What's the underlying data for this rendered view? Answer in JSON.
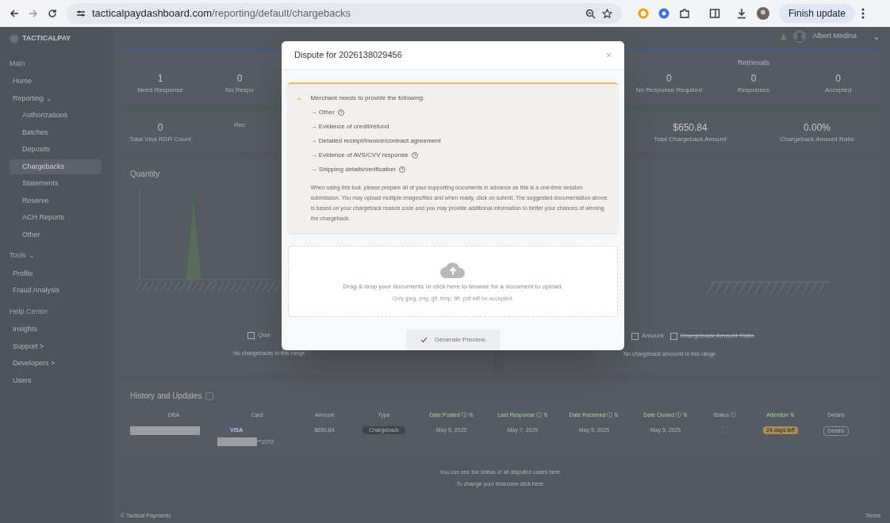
{
  "browser": {
    "url_host": "tacticalpaydashboard.com",
    "url_path": "/reporting/default/chargebacks",
    "update_button": "Finish update"
  },
  "sidebar": {
    "brand": "TACTICALPAY",
    "sections": [
      {
        "title": "Main",
        "items": [
          {
            "label": "Home",
            "selected": false
          },
          {
            "label": "Reporting ⌄",
            "selected": false,
            "children": [
              {
                "label": "Authorizations",
                "selected": false
              },
              {
                "label": "Batches",
                "selected": false
              },
              {
                "label": "Deposits",
                "selected": false
              },
              {
                "label": "Chargebacks",
                "selected": true
              },
              {
                "label": "Statements",
                "selected": false
              },
              {
                "label": "Reserve",
                "selected": false
              },
              {
                "label": "ACH Reports",
                "selected": false
              },
              {
                "label": "Other",
                "selected": false
              }
            ]
          }
        ]
      },
      {
        "title": "Tools ⌄",
        "items": [
          {
            "label": "Profile",
            "selected": false
          },
          {
            "label": "Fraud Analysis",
            "selected": false
          }
        ]
      },
      {
        "title": "Help Center",
        "items": [
          {
            "label": "Insights",
            "selected": false
          },
          {
            "label": "Support >",
            "selected": false
          },
          {
            "label": "Developers >",
            "selected": false
          },
          {
            "label": "Users",
            "selected": false
          }
        ]
      }
    ]
  },
  "user": {
    "name": "Albert Medina",
    "caret": "⌄"
  },
  "stats_row_1": {
    "left": [
      {
        "value": "1",
        "label": "Need Response"
      },
      {
        "value": "0",
        "label": "No Respo"
      }
    ],
    "retrievals": {
      "title": "Retrievals",
      "items": [
        {
          "value": "0",
          "label": "No Response Required"
        },
        {
          "value": "0",
          "label": "Responses"
        },
        {
          "value": "0",
          "label": "Accepted"
        }
      ]
    }
  },
  "stats_row_2": {
    "left": [
      {
        "value": "0",
        "label": "Total Visa RDR Count"
      },
      {
        "label": "Rec"
      }
    ],
    "right": [
      {
        "value": "$650.84",
        "label": "Total Chargeback Amount"
      },
      {
        "value": "0.00%",
        "label": "Chargeback Amount Ratio"
      }
    ]
  },
  "chart_panel": {
    "title": "Quantity",
    "checkbox": {
      "label": "Qua",
      "checked": false
    },
    "note": "No chargebacks in this range"
  },
  "amount_panel": {
    "checkboxes": [
      {
        "label": "Amount",
        "checked": false,
        "struck": false
      },
      {
        "label": "Chargeback Amount Ratio",
        "checked": false,
        "struck": true
      }
    ],
    "note": "No chargeback amounts in this range"
  },
  "history": {
    "title": "History and Updates",
    "columns": [
      {
        "label": "DBA",
        "sortable": false
      },
      {
        "label": "Card",
        "sortable": false
      },
      {
        "label": "Amount",
        "sortable": false
      },
      {
        "label": "Type",
        "sortable": false
      },
      {
        "label": "Date Posted ⓘ ⇅",
        "sortable": true
      },
      {
        "label": "Last Response ⓘ ⇅",
        "sortable": true
      },
      {
        "label": "Date Received ⓘ ⇅",
        "sortable": true
      },
      {
        "label": "Date Closed ⓘ ⇅",
        "sortable": true
      },
      {
        "label": "Status ⓘ",
        "sortable": false
      },
      {
        "label": "Attention ⇅",
        "sortable": true
      },
      {
        "label": "Details",
        "sortable": false
      }
    ],
    "rows": [
      {
        "card_brand": "VISA",
        "card_suffix": "**1072",
        "amount": "$650.84",
        "type": "Chargeback",
        "date_posted": "May 5, 2025",
        "last_response": "May 7, 2025",
        "date_received": "May 5, 2025",
        "date_closed": "May 5, 2025",
        "attention": "24 days left",
        "details": "Details"
      }
    ]
  },
  "footer_notes": [
    "You can see the status of all disputed cases here.",
    "To change your timezone click here."
  ],
  "footer": {
    "left": "© Tactical Payments",
    "right": "Terms"
  },
  "modal": {
    "title": "Dispute for 2026138029456",
    "close": "×",
    "warning_title": "Merchant needs to provide the following:",
    "requirements": [
      {
        "text": "→ Other",
        "help": true
      },
      {
        "text": "→ Evidence of credit/refund",
        "help": false
      },
      {
        "text": "→ Detailed receipt/invoice/contract agreement",
        "help": false
      },
      {
        "text": "→ Evidence of AVS/CVV response",
        "help": true
      },
      {
        "text": "→ Shipping details/verification",
        "help": true
      }
    ],
    "instructions": "When using this tool, please prepare all of your supporting documents in advance as this is a one-time session submission. You may upload multiple images/files and when ready, click on submit. The suggested documentation above is based on your chargeback reason code and you may provide additional information to better your chances of winning the chargeback.",
    "dropzone": {
      "text": "Drag & drop your documents or click here to browse for a document to upload.",
      "hint": "Only jpeg, png, gif, bmp, tiff, pdf will be accepted."
    },
    "button": "Generate Preview"
  }
}
